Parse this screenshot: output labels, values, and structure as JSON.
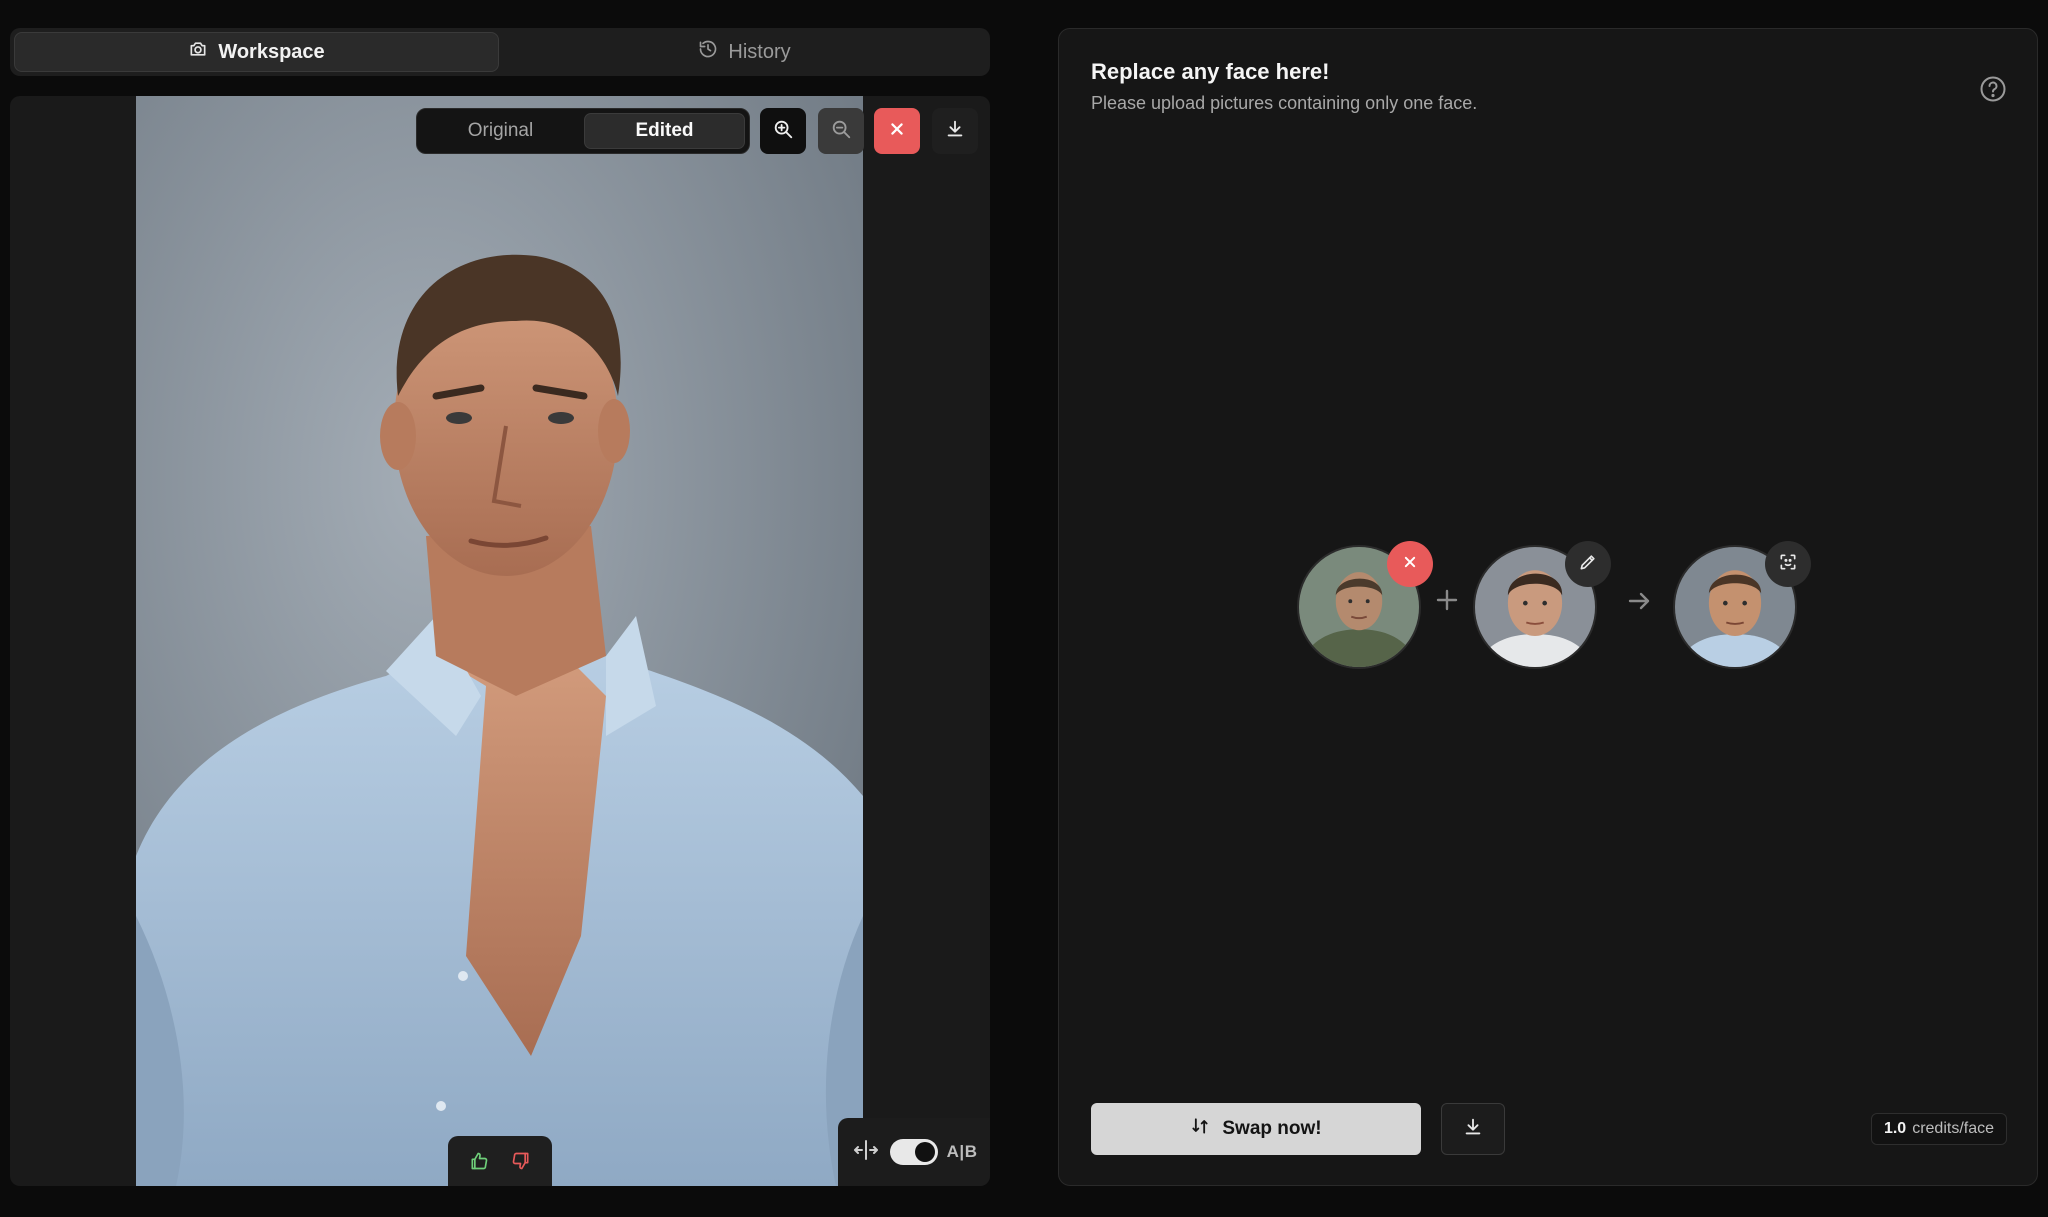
{
  "tabs": [
    {
      "label": "Workspace",
      "icon": "camera-icon",
      "active": true
    },
    {
      "label": "History",
      "icon": "history-icon",
      "active": false
    }
  ],
  "editor": {
    "compare": {
      "original_label": "Original",
      "edited_label": "Edited",
      "active": "Edited"
    },
    "tools": [
      "zoom-in-icon",
      "zoom-out-icon",
      "close-icon",
      "download-icon"
    ],
    "ab_label": "A|B",
    "ab_toggle_on": true,
    "feedback": [
      "thumbs-up-icon",
      "thumbs-down-icon"
    ]
  },
  "panel": {
    "title": "Replace any face here!",
    "subtitle": "Please upload pictures containing only one face.",
    "swap_label": "Swap now!",
    "credits_value": "1.0",
    "credits_unit": "credits/face"
  },
  "colors": {
    "accent_red": "#e85a5a",
    "background": "#0b0b0b",
    "panel": "#161616",
    "thumbs_up": "#6fcf7a",
    "thumbs_down": "#e85a5a"
  }
}
